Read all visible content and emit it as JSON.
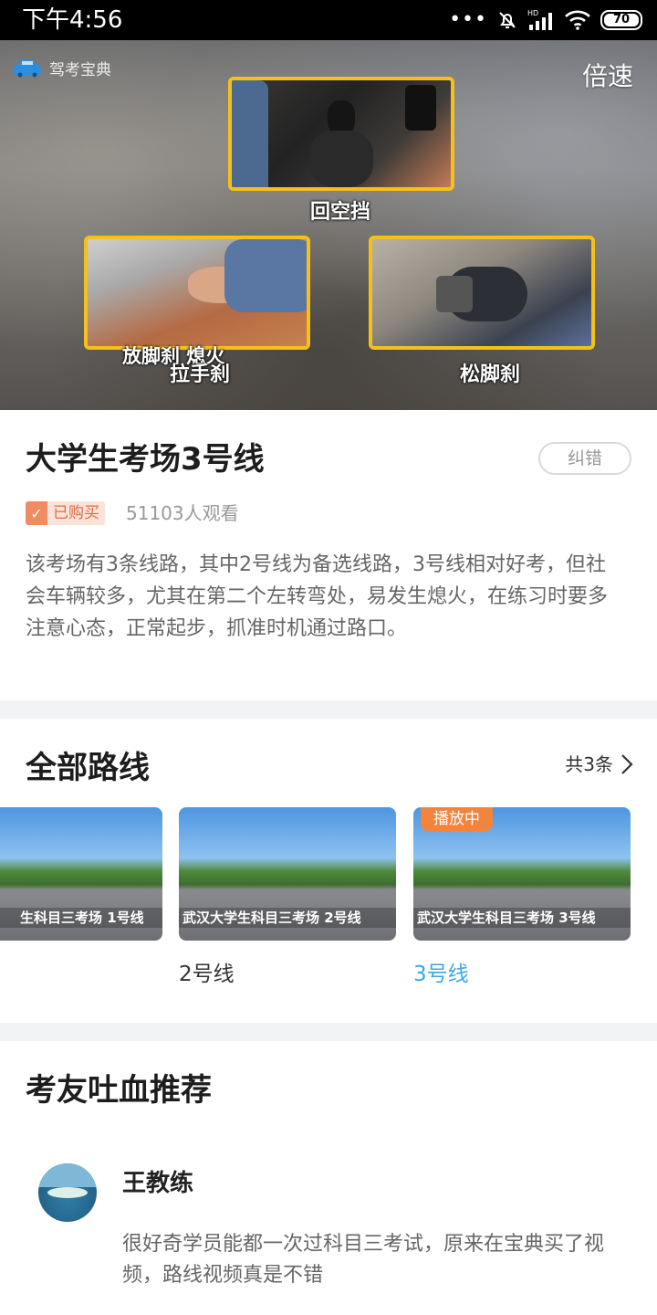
{
  "status_bar": {
    "time": "下午4:56",
    "dots": "•••",
    "battery": "70",
    "icons": [
      "mute-bell-icon",
      "hd-signal-icon",
      "wifi-icon",
      "battery-icon"
    ]
  },
  "video": {
    "app_name": "驾考宝典",
    "speed_label": "倍速",
    "captions": {
      "top": "回空挡",
      "left_upper": "放脚刹  熄火",
      "left_lower": "拉手刹",
      "right": "松脚刹"
    }
  },
  "info": {
    "title": "大学生考场3号线",
    "report_label": "纠错",
    "bought_label": "已购买",
    "views": "51103人观看",
    "description": "该考场有3条线路，其中2号线为备选线路，3号线相对好考，但社会车辆较多，尤其在第二个左转弯处，易发生熄火，在练习时要多注意心态，正常起步，抓准时机通过路口。"
  },
  "routes": {
    "title": "全部路线",
    "count_label": "共3条",
    "items": [
      {
        "label": "",
        "banner": "生科目三考场 1号线",
        "playing": false
      },
      {
        "label": "2号线",
        "banner": "武汉大学生科目三考场 2号线",
        "playing": false
      },
      {
        "label": "3号线",
        "banner": "武汉大学生科目三考场 3号线",
        "playing": true,
        "playing_label": "播放中"
      }
    ]
  },
  "recommend": {
    "title": "考友吐血推荐",
    "name": "王教练",
    "text": "很好奇学员能都一次过科目三考试，原来在宝典买了视频，路线视频真是不错"
  },
  "colors": {
    "accent_blue": "#3aa7e8",
    "frame_yellow": "#f6c01c",
    "badge_orange": "#f08c64",
    "playing_orange": "#f3843d"
  }
}
